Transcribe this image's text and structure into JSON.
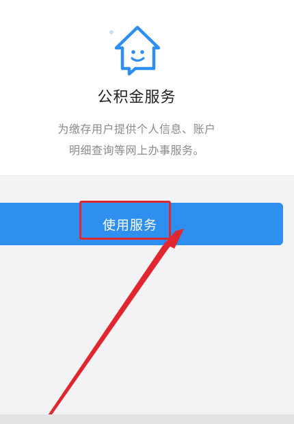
{
  "service": {
    "icon": "house-smile-icon",
    "title": "公积金服务",
    "description_line1": "为缴存用户提供个人信息、账户",
    "description_line2": "明细查询等网上办事服务。"
  },
  "action": {
    "use_label": "使用服务"
  },
  "colors": {
    "accent": "#2f8ff0",
    "annotation": "#e0272f"
  }
}
